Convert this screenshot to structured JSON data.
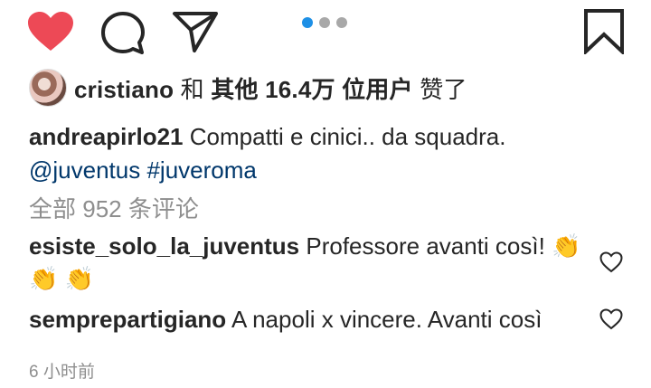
{
  "actions": {
    "like_icon": "heart-filled-icon",
    "comment_icon": "comment-bubble-icon",
    "share_icon": "paper-plane-icon",
    "save_icon": "bookmark-icon",
    "like_color": "#ed4956"
  },
  "carousel": {
    "count": 3,
    "active_index": 0,
    "active_color": "#1e90e6"
  },
  "likes": {
    "user": "cristiano",
    "connector": "和",
    "others_label": "其他",
    "count": "16.4万",
    "suffix": "位用户",
    "verb": "赞了"
  },
  "caption": {
    "username": "andreapirlo21",
    "text": "Compatti e cinici.. da squadra.",
    "mention": "@juventus",
    "hashtag": "#juveroma"
  },
  "comments_summary": {
    "label": "全部",
    "count": "952",
    "suffix": "条评论"
  },
  "comments": [
    {
      "username": "esiste_solo_la_juventus",
      "text": "Professore avanti così!",
      "emoji_1": "👏",
      "emoji_2": "👏",
      "emoji_3": "👏"
    },
    {
      "username": "semprepartigiano",
      "text": "A napoli x vincere. Avanti così"
    }
  ],
  "timestamp": "6 小时前"
}
